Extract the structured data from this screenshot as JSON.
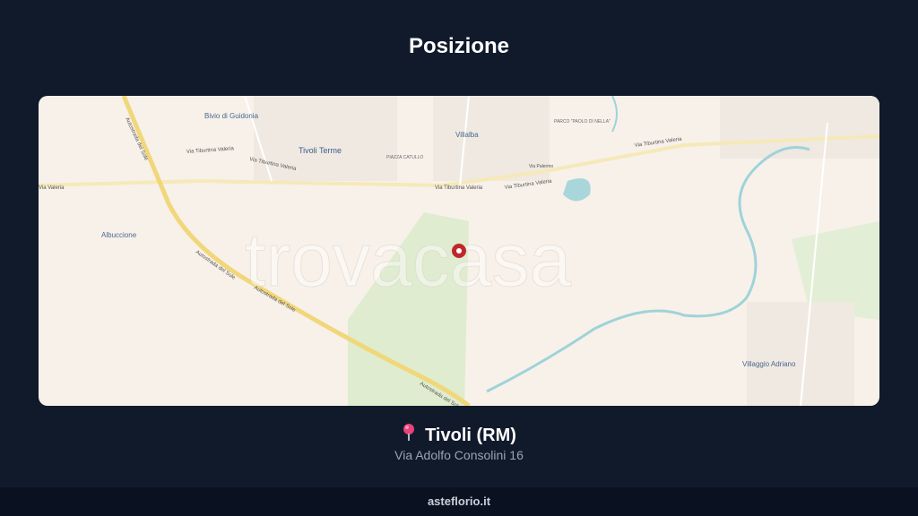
{
  "header": {
    "title": "Posizione"
  },
  "map": {
    "watermark": "trovacasa",
    "labels": {
      "bivio": "Bivio di Guidonia",
      "tivoli_terme": "Tivoli Terme",
      "villalba": "Villalba",
      "albuccione": "Albuccione",
      "villaggio_adriano": "Villaggio Adriano",
      "piazza_catullo": "PIAZZA CATULLO",
      "parco": "PARCO \"PAOLO DI NELLA\"",
      "via_tiburtina_1": "Via Tiburtina Valeria",
      "via_tiburtina_2": "Via Tiburtina Valeria",
      "via_tiburtina_3": "Via Tiburtina Valeria",
      "via_tiburtina_4": "Via Tiburtina Valeria",
      "via_tiburtina_5": "Via Tiburtina Valeria",
      "via_valeria_left": "Via Valeria",
      "autostrada_1": "Autostrada del Sole",
      "autostrada_2": "Autostrada del Sole",
      "autostrada_3": "Autostrada del Sole",
      "autostrada_4": "Autostrada del Sole",
      "via_palermo": "Via Palermo"
    },
    "colors": {
      "land": "#f7f1ea",
      "park": "#d8e8c8",
      "road": "#f3dd8c",
      "water": "#9fd3d8",
      "marker": "#c0272d"
    }
  },
  "location": {
    "icon": "pin-icon",
    "city": "Tivoli (RM)",
    "address": "Via Adolfo Consolini 16"
  },
  "footer": {
    "brand": "asteflorio.it"
  }
}
